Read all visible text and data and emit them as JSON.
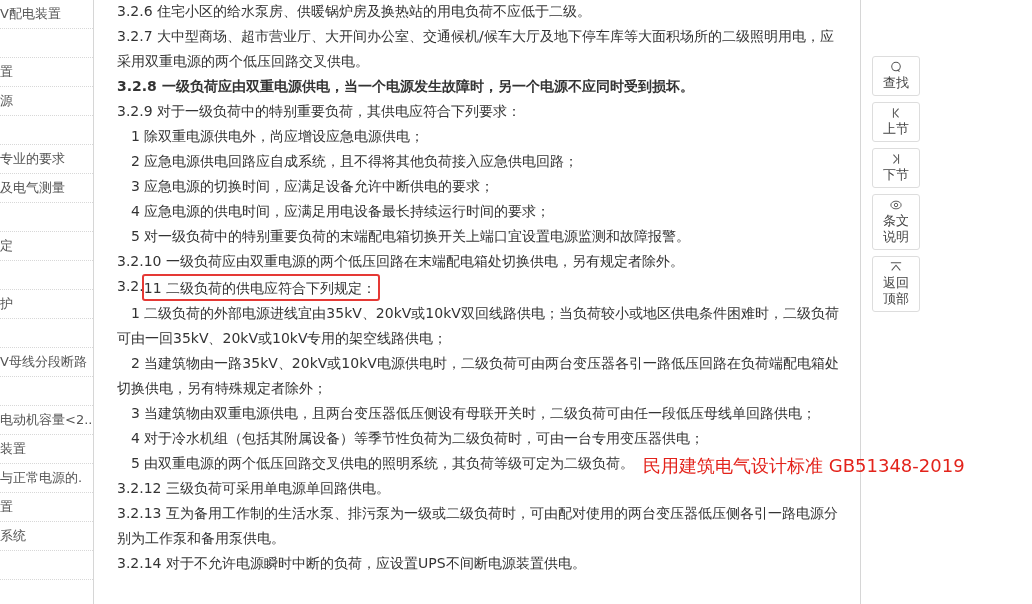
{
  "sidebar": {
    "items": [
      {
        "kind": "entry",
        "text": "V配电装置"
      },
      {
        "kind": "blank"
      },
      {
        "kind": "entry",
        "text": "置"
      },
      {
        "kind": "entry",
        "text": "源"
      },
      {
        "kind": "blank"
      },
      {
        "kind": "entry",
        "text": "专业的要求"
      },
      {
        "kind": "entry",
        "text": "及电气测量"
      },
      {
        "kind": "blank"
      },
      {
        "kind": "entry",
        "text": "定"
      },
      {
        "kind": "blank"
      },
      {
        "kind": "entry",
        "text": "护"
      },
      {
        "kind": "blank"
      },
      {
        "kind": "entry",
        "text": "V母线分段断路"
      },
      {
        "kind": "blank"
      },
      {
        "kind": "entry",
        "text": "电动机容量<2.."
      },
      {
        "kind": "entry",
        "text": "装置"
      },
      {
        "kind": "entry",
        "text": "与正常电源的."
      },
      {
        "kind": "entry",
        "text": "置"
      },
      {
        "kind": "entry",
        "text": "系统"
      },
      {
        "kind": "blank"
      }
    ]
  },
  "content": {
    "paragraphs": [
      {
        "kind": "clause",
        "text": "3.2.6 住宅小区的给水泵房、供暖锅炉房及换热站的用电负荷不应低于二级。"
      },
      {
        "kind": "clause",
        "text": "3.2.7 大中型商场、超市营业厅、大开间办公室、交通候机/候车大厅及地下停车库等大面积场所的二级照明用电，应采用双重电源的两个低压回路交叉供电。"
      },
      {
        "kind": "bold",
        "text": "3.2.8 一级负荷应由双重电源供电，当一个电源发生故障时，另一个电源不应同时受到损坏。"
      },
      {
        "kind": "clause",
        "text": "3.2.9 对于一级负荷中的特别重要负荷，其供电应符合下列要求："
      },
      {
        "kind": "item",
        "text": "1 除双重电源供电外，尚应增设应急电源供电；"
      },
      {
        "kind": "item",
        "text": "2 应急电源供电回路应自成系统，且不得将其他负荷接入应急供电回路；"
      },
      {
        "kind": "item",
        "text": "3 应急电源的切换时间，应满足设备允许中断供电的要求；"
      },
      {
        "kind": "item",
        "text": "4 应急电源的供电时间，应满足用电设备最长持续运行时间的要求；"
      },
      {
        "kind": "item",
        "text": "5 对一级负荷中的特别重要负荷的末端配电箱切换开关上端口宜设置电源监测和故障报警。"
      },
      {
        "kind": "clause",
        "text": "3.2.10 一级负荷应由双重电源的两个低压回路在末端配电箱处切换供电，另有规定者除外。"
      },
      {
        "kind": "clause",
        "text": "3.2.",
        "boxed": "11 二级负荷的供电应符合下列规定："
      },
      {
        "kind": "item",
        "text": "1 二级负荷的外部电源进线宜由35kV、20kV或10kV双回线路供电；当负荷较小或地区供电条件困难时，二级负荷可由一回35kV、20kV或10kV专用的架空线路供电；"
      },
      {
        "kind": "item",
        "text": "2 当建筑物由一路35kV、20kV或10kV电源供电时，二级负荷可由两台变压器各引一路低压回路在负荷端配电箱处切换供电，另有特殊规定者除外；"
      },
      {
        "kind": "item",
        "text": "3 当建筑物由双重电源供电，且两台变压器低压侧设有母联开关时，二级负荷可由任一段低压母线单回路供电；"
      },
      {
        "kind": "item",
        "text": "4 对于冷水机组（包括其附属设备）等季节性负荷为二级负荷时，可由一台专用变压器供电；"
      },
      {
        "kind": "item",
        "text": "5 由双重电源的两个低压回路交叉供电的照明系统，其负荷等级可定为二级负荷。"
      },
      {
        "kind": "clause",
        "text": "3.2.12 三级负荷可采用单电源单回路供电。"
      },
      {
        "kind": "clause",
        "text": "3.2.13 互为备用工作制的生活水泵、排污泵为一级或二级负荷时，可由配对使用的两台变压器低压侧各引一路电源分别为工作泵和备用泵供电。"
      },
      {
        "kind": "clause",
        "text": "3.2.14 对于不允许电源瞬时中断的负荷，应设置UPS不间断电源装置供电。"
      }
    ]
  },
  "tools": [
    {
      "kind": "search",
      "label": "查找"
    },
    {
      "kind": "prev",
      "label": "上节"
    },
    {
      "kind": "next",
      "label": "下节"
    },
    {
      "kind": "notes",
      "label": "条文说明"
    },
    {
      "kind": "top",
      "label": "返回顶部"
    }
  ],
  "annotation": {
    "text": "民用建筑电气设计标准 GB51348-2019"
  }
}
